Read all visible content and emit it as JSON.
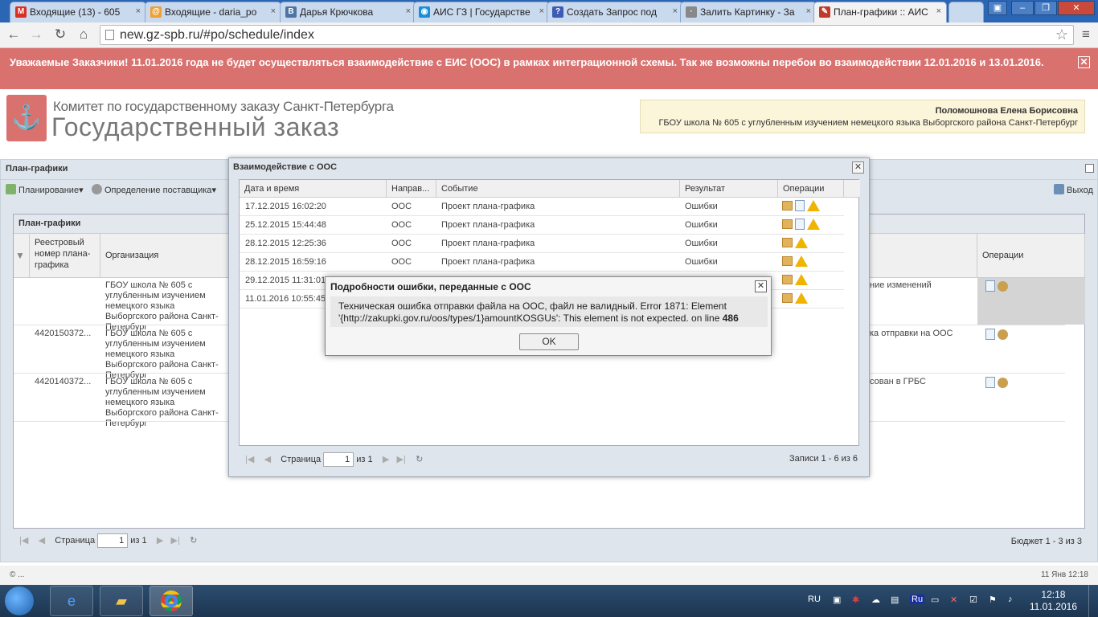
{
  "browser": {
    "tabs": [
      {
        "title": "Входящие (13) - 605",
        "icon": "M",
        "icon_color": "#d93025"
      },
      {
        "title": "Входящие - daria_po",
        "icon": "@",
        "icon_color": "#f0a030"
      },
      {
        "title": "Дарья Крючкова",
        "icon": "B",
        "icon_color": "#4c75a3"
      },
      {
        "title": "АИС ГЗ | Государстве",
        "icon": "◉",
        "icon_color": "#1a8ed8"
      },
      {
        "title": "Создать Запрос под",
        "icon": "?",
        "icon_color": "#3b5bb5"
      },
      {
        "title": "Залить Картинку - За",
        "icon": "·",
        "icon_color": "#888888"
      },
      {
        "title": "План-графики :: АИС",
        "icon": "✎",
        "icon_color": "#c0392b"
      }
    ],
    "url": "new.gz-spb.ru/#po/schedule/index"
  },
  "banner": {
    "text": "Уважаемые Заказчики! 11.01.2016 года не будет осуществляться взаимодействие с ЕИС (ООС) в рамках интеграционной схемы. Так же возможны перебои во взаимодействии 12.01.2016 и 13.01.2016."
  },
  "header": {
    "org_line1": "Комитет по государственному заказу Санкт-Петербурга",
    "org_line2": "Государственный заказ",
    "user_name": "Поломошнова Елена Борисовна",
    "user_org": "ГБОУ школа № 605 с углубленным изучением немецкого языка Выборгского района Санкт-Петербург"
  },
  "main": {
    "panel_title": "План-графики",
    "toolbar": {
      "planning": "Планирование",
      "supplier": "Определение поставщика",
      "exit": "Выход"
    },
    "grid_title": "План-графики",
    "columns": [
      "Реестровый номер плана-графика",
      "Организация",
      "Операции"
    ],
    "rows": [
      {
        "reg": "",
        "org": "ГБОУ школа № 605 с углубленным изучением немецкого языка Выборгского района Санкт-Петербург",
        "status": "ние изменений"
      },
      {
        "reg": "4420150372...",
        "org": "ГБОУ школа № 605 с углубленным изучением немецкого языка Выборгского района Санкт-Петербург",
        "status": "ка отправки на ООС"
      },
      {
        "reg": "4420140372...",
        "org": "ГБОУ школа № 605 с углубленным изучением немецкого языка Выборгского района Санкт-Петербург",
        "status": "сован в ГРБС"
      }
    ],
    "pager": {
      "page_label": "Страница",
      "page": "1",
      "of": "из 1",
      "summary": "Бюджет 1 - 3 из 3"
    }
  },
  "dialog_oos": {
    "title": "Взаимодействие с ООС",
    "columns": [
      "Дата и время",
      "Направ...",
      "Событие",
      "Результат",
      "Операции"
    ],
    "rows": [
      {
        "datetime": "17.12.2015 16:02:20",
        "direction": "ООС",
        "event": "Проект плана-графика",
        "result": "Ошибки"
      },
      {
        "datetime": "25.12.2015 15:44:48",
        "direction": "ООС",
        "event": "Проект плана-графика",
        "result": "Ошибки"
      },
      {
        "datetime": "28.12.2015 12:25:36",
        "direction": "ООС",
        "event": "Проект плана-графика",
        "result": "Ошибки"
      },
      {
        "datetime": "28.12.2015 16:59:16",
        "direction": "ООС",
        "event": "Проект плана-графика",
        "result": "Ошибки"
      },
      {
        "datetime": "29.12.2015 11:31:01",
        "direction": "",
        "event": "",
        "result": ""
      },
      {
        "datetime": "11.01.2016 10:55:45",
        "direction": "",
        "event": "",
        "result": ""
      }
    ],
    "pager": {
      "page_label": "Страница",
      "page": "1",
      "of": "из 1",
      "summary": "Записи 1 - 6 из 6"
    }
  },
  "dialog_error": {
    "title": "Подробности ошибки, переданные с ООС",
    "message": "Техническая ошибка отправки файла на ООС, файл не валидный. Error 1871: Element '{http://zakupki.gov.ru/oos/types/1}amountKOSGUs': This element is not expected. on line",
    "line_no": "486",
    "ok": "OK"
  },
  "statusbar": {
    "left": "© ...",
    "right": "11 Янв 12:18"
  },
  "taskbar": {
    "lang": "RU",
    "time": "12:18",
    "date": "11.01.2016"
  }
}
